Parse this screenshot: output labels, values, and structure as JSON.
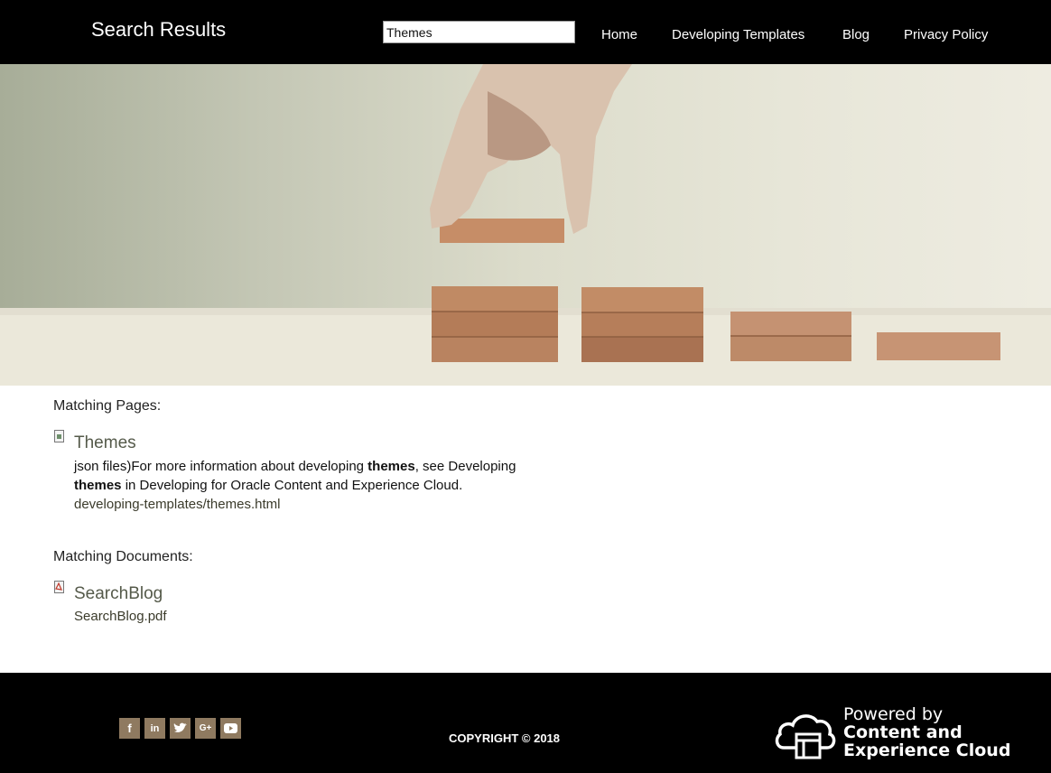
{
  "header": {
    "title": "Search Results",
    "search_value": "Themes",
    "nav": {
      "home": "Home",
      "developing_templates": "Developing Templates",
      "blog": "Blog",
      "privacy_policy": "Privacy Policy"
    }
  },
  "hero": {
    "image": "hand-stacking-wooden-blocks"
  },
  "results": {
    "pages_heading": "Matching Pages:",
    "pages": [
      {
        "icon": "page-icon",
        "title": "Themes",
        "snippet_part1": "json files)For more information about developing ",
        "snippet_bold1": "themes",
        "snippet_part2": ", see Developing ",
        "snippet_bold2": "themes",
        "snippet_part3": " in Developing for Oracle Content and Experience Cloud.",
        "url": "developing-templates/themes.html"
      }
    ],
    "documents_heading": "Matching Documents:",
    "documents": [
      {
        "icon": "pdf-icon",
        "title": "SearchBlog",
        "url": "SearchBlog.pdf"
      }
    ]
  },
  "footer": {
    "social": [
      "facebook-icon",
      "linkedin-icon",
      "twitter-icon",
      "google-plus-icon",
      "youtube-icon"
    ],
    "copyright": "COPYRIGHT © 2018",
    "powered_line1": "Powered by",
    "powered_line2": "Content and",
    "powered_line3": "Experience Cloud"
  },
  "colors": {
    "header_bg": "#000000",
    "footer_bg": "#000000",
    "link_title": "#555a4a",
    "social_bg": "#8f7a60"
  }
}
